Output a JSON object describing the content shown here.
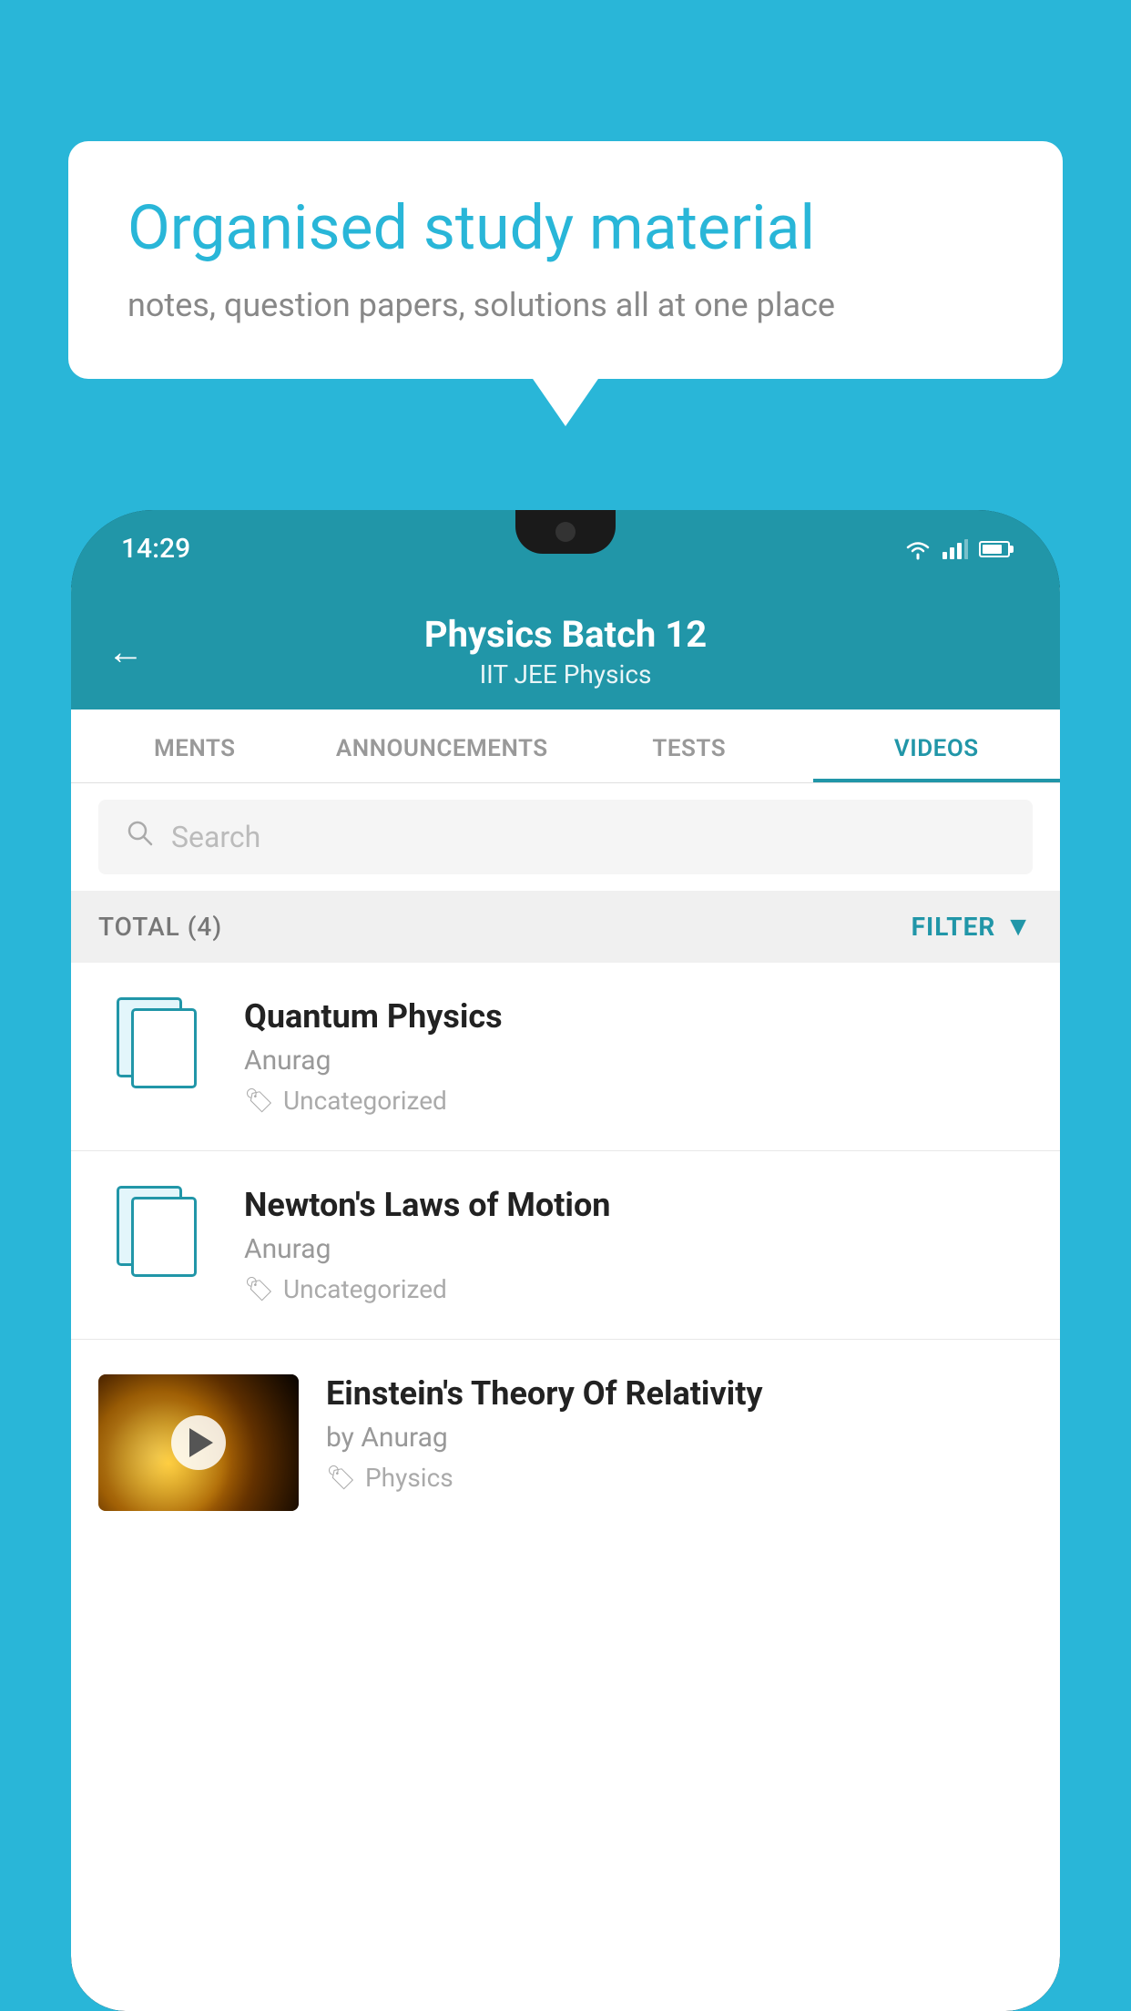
{
  "background": {
    "color": "#29b6d8"
  },
  "speech_bubble": {
    "title": "Organised study material",
    "subtitle": "notes, question papers, solutions all at one place"
  },
  "phone": {
    "status_bar": {
      "time": "14:29"
    },
    "header": {
      "title": "Physics Batch 12",
      "subtitle": "IIT JEE    Physics",
      "back_label": "←"
    },
    "tabs": [
      {
        "label": "MENTS",
        "active": false
      },
      {
        "label": "ANNOUNCEMENTS",
        "active": false
      },
      {
        "label": "TESTS",
        "active": false
      },
      {
        "label": "VIDEOS",
        "active": true
      }
    ],
    "search": {
      "placeholder": "Search"
    },
    "filter_row": {
      "total_label": "TOTAL (4)",
      "filter_label": "FILTER"
    },
    "videos": [
      {
        "id": 1,
        "title": "Quantum Physics",
        "author": "Anurag",
        "tag": "Uncategorized",
        "has_thumbnail": false
      },
      {
        "id": 2,
        "title": "Newton's Laws of Motion",
        "author": "Anurag",
        "tag": "Uncategorized",
        "has_thumbnail": false
      },
      {
        "id": 3,
        "title": "Einstein's Theory Of Relativity",
        "author": "by Anurag",
        "tag": "Physics",
        "has_thumbnail": true
      }
    ]
  }
}
